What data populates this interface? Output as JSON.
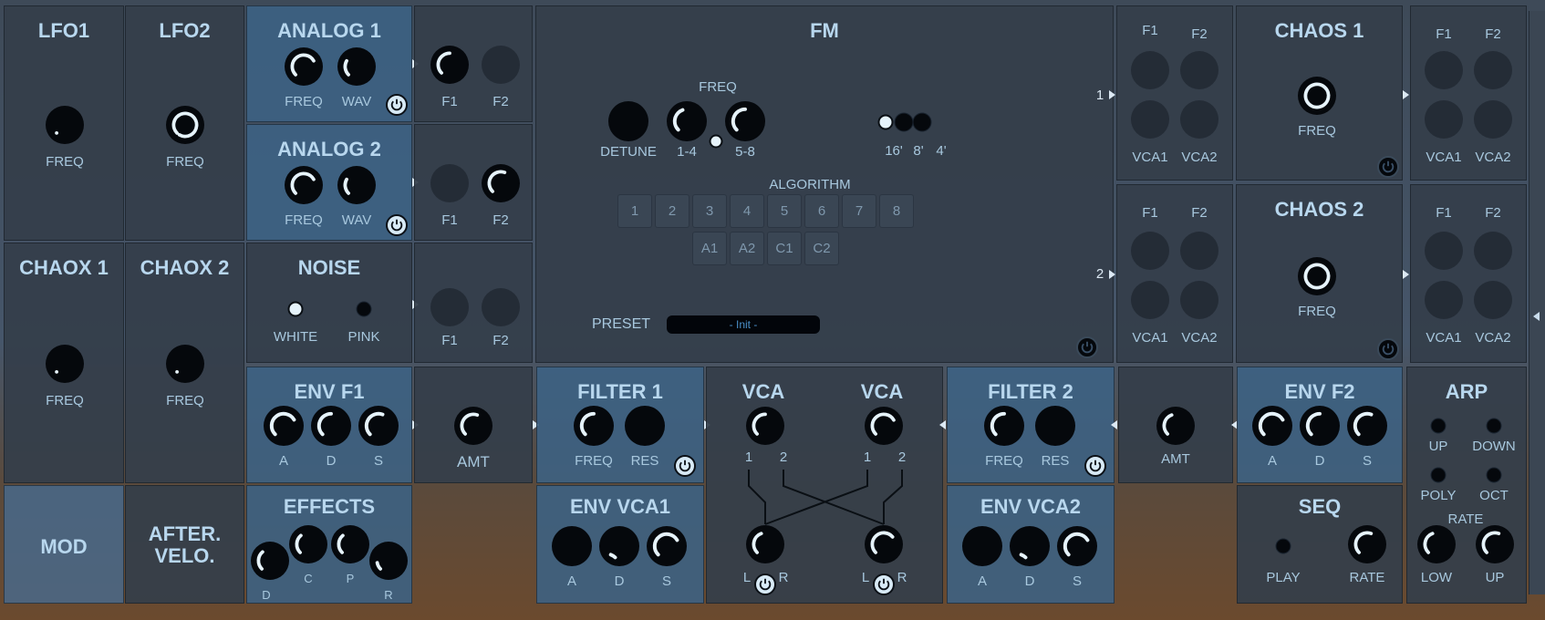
{
  "lfo1": {
    "title": "LFO1",
    "freq": "FREQ"
  },
  "lfo2": {
    "title": "LFO2",
    "freq": "FREQ"
  },
  "chaox1": {
    "title": "CHAOX 1",
    "freq": "FREQ"
  },
  "chaox2": {
    "title": "CHAOX 2",
    "freq": "FREQ"
  },
  "mod": {
    "label": "MOD"
  },
  "after": {
    "line1": "AFTER.",
    "line2": "VELO."
  },
  "analog1": {
    "title": "ANALOG 1",
    "freq": "FREQ",
    "wav": "WAV"
  },
  "analog2": {
    "title": "ANALOG 2",
    "freq": "FREQ",
    "wav": "WAV"
  },
  "noise": {
    "title": "NOISE",
    "white": "WHITE",
    "pink": "PINK"
  },
  "effects": {
    "title": "EFFECTS",
    "d": "D",
    "c": "C",
    "p": "P",
    "r": "R"
  },
  "route": {
    "f1": "F1",
    "f2": "F2"
  },
  "fm": {
    "title": "FM",
    "freq": "FREQ",
    "detune": "DETUNE",
    "r14": "1-4",
    "r58": "5-8",
    "oct16": "16'",
    "oct8": "8'",
    "oct4": "4'",
    "algorithm": "ALGORITHM",
    "alg_row1": [
      "1",
      "2",
      "3",
      "4",
      "5",
      "6",
      "7",
      "8"
    ],
    "alg_row2": [
      "A1",
      "A2",
      "C1",
      "C2"
    ],
    "preset_label": "PRESET",
    "preset_value": "- Init -"
  },
  "out": {
    "n1": "1",
    "n2": "2",
    "f1": "F1",
    "f2": "F2",
    "vca1": "VCA1",
    "vca2": "VCA2"
  },
  "chaos1": {
    "title": "CHAOS 1",
    "freq": "FREQ"
  },
  "chaos2": {
    "title": "CHAOS 2",
    "freq": "FREQ"
  },
  "envf1": {
    "title": "ENV F1",
    "a": "A",
    "d": "D",
    "s": "S"
  },
  "envf2": {
    "title": "ENV F2",
    "a": "A",
    "d": "D",
    "s": "S"
  },
  "amt": {
    "label": "AMT"
  },
  "filter1": {
    "title": "FILTER 1",
    "freq": "FREQ",
    "res": "RES"
  },
  "filter2": {
    "title": "FILTER 2",
    "freq": "FREQ",
    "res": "RES"
  },
  "vca": {
    "title": "VCA",
    "one": "1",
    "two": "2",
    "l": "L",
    "r": "R"
  },
  "envvca1": {
    "title": "ENV VCA1",
    "a": "A",
    "d": "D",
    "s": "S"
  },
  "envvca2": {
    "title": "ENV VCA2",
    "a": "A",
    "d": "D",
    "s": "S"
  },
  "arp": {
    "title": "ARP",
    "up": "UP",
    "down": "DOWN",
    "poly": "POLY",
    "oct": "OCT",
    "rate": "RATE",
    "low": "LOW",
    "upk": "UP"
  },
  "seq": {
    "title": "SEQ",
    "play": "PLAY",
    "rate": "RATE"
  },
  "colors": {
    "panel": "#343e4a",
    "accent": "#b8d7ee",
    "label": "#a8c8de",
    "knob": "#05080c",
    "arc": "#e6f3fb"
  }
}
